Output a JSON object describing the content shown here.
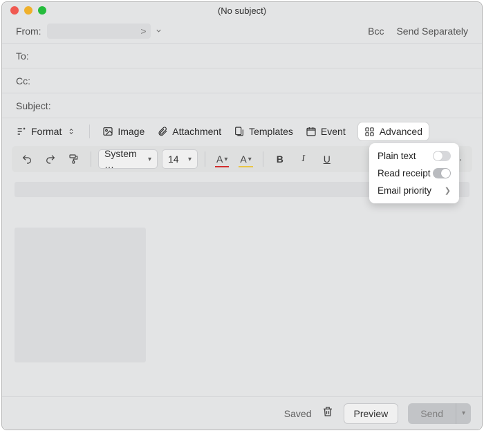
{
  "window": {
    "title": "(No subject)"
  },
  "header": {
    "from_label": "From:",
    "from_value_suffix": ">",
    "to_label": "To:",
    "cc_label": "Cc:",
    "subject_label": "Subject:",
    "bcc": "Bcc",
    "send_separately": "Send Separately"
  },
  "toolbar1": {
    "format": "Format",
    "image": "Image",
    "attachment": "Attachment",
    "templates": "Templates",
    "event": "Event",
    "advanced": "Advanced"
  },
  "toolbar2": {
    "font": "System …",
    "size": "14",
    "text_color_glyph": "A",
    "highlight_glyph": "A",
    "bold": "B",
    "italic": "I",
    "underline": "U",
    "quote": "❝",
    "more": "···"
  },
  "advanced_menu": {
    "plain_text": "Plain text",
    "read_receipt": "Read receipt",
    "email_priority": "Email priority"
  },
  "footer": {
    "saved": "Saved",
    "preview": "Preview",
    "send": "Send"
  }
}
